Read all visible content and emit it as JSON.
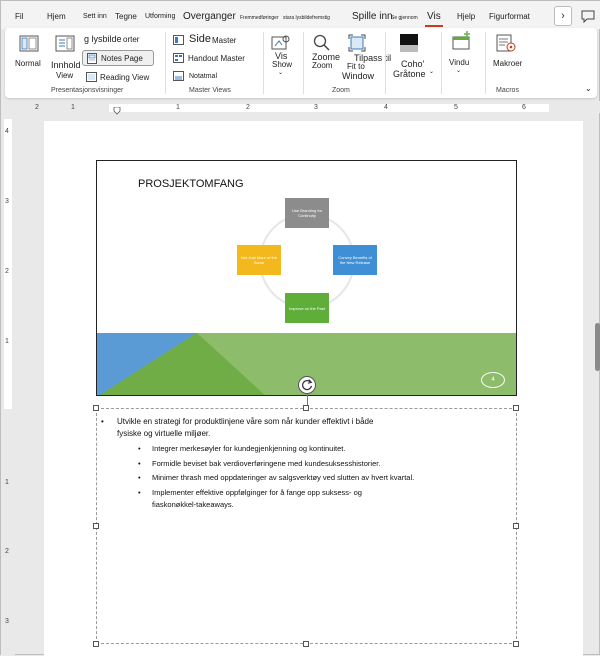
{
  "tabs": [
    {
      "label": "Fil",
      "active": false
    },
    {
      "label": "Hjem",
      "active": false
    },
    {
      "label": "Sett inn",
      "active": false
    },
    {
      "label": "Tegne",
      "active": false
    },
    {
      "label": "Utforming",
      "active": false
    },
    {
      "label": "Overganger",
      "active": false
    },
    {
      "label": "Fremmedføringer",
      "active": false
    },
    {
      "label": "stara lysbildefremstig",
      "active": false
    },
    {
      "label": "Spille inn",
      "active": false
    },
    {
      "label": "Se gjennom",
      "active": false
    },
    {
      "label": "Vis",
      "active": true
    },
    {
      "label": "Hjelp",
      "active": false
    },
    {
      "label": "Figurformat",
      "active": false
    }
  ],
  "more_tabs_icon": "chevron-right-icon",
  "comment_icon": "comment-icon",
  "ribbon": {
    "normal": "Normal",
    "innhold": "Innhold",
    "view": "View",
    "lysbilde": "g lysbilde",
    "sorter": "orter",
    "notes_page": "Notes Page",
    "reading_view": "Reading View",
    "group_presentasjon": "Presentasjonsvisninger",
    "side": "Side",
    "master": "Master",
    "handout_master": "Handout Master",
    "notatmal": "Notatmal",
    "group_master_views": "Master Views",
    "vis": "Vis",
    "show": "Show",
    "zoome": "Zoome",
    "zoom": "Zoom",
    "tilpass_til": "Tilpass til",
    "fit_to": "Fit to",
    "window": "Window",
    "group_zoom": "Zoom",
    "coho": "Coho'",
    "gratone": "Gråtone",
    "vindu": "Vindu",
    "makroer": "Makroer",
    "group_macros": "Macros",
    "collapse_icon": "chevron-down-icon"
  },
  "ruler_h": [
    "2",
    "1",
    "1",
    "2",
    "3",
    "4",
    "5",
    "6"
  ],
  "ruler_v": [
    "4",
    "3",
    "2",
    "1",
    "1",
    "2",
    "3"
  ],
  "slide": {
    "title": "PROSJEKTOMFANG",
    "boxes": {
      "top": "Use Branding for Continuity",
      "right": "Convey Benefits of the New Release",
      "bottom": "Improve on the Past",
      "left": "Not Just More of the Same"
    },
    "number": "4",
    "colors": {
      "top": "#8c8c8c",
      "right": "#3f8fd6",
      "bottom": "#5fae3a",
      "left": "#f2b81c",
      "blue": "#5b9bd5",
      "green_light": "#8dbd6a",
      "green_dark": "#70ad47"
    }
  },
  "notes": {
    "line1a": "Utvikle en strategi for produktlinjene våre som når kunder effektivt i både",
    "line1b": "fysiske og virtuelle miljøer.",
    "bullets": [
      "Integrer merkesøyler for kundegjenkjenning og kontinuitet.",
      "Formidle beviset bak verdioverføringene med kundesuksesshistorier.",
      "Minimer thrash med oppdateringer av salgsverktøy ved slutten av hvert kvartal.",
      "Implementer effektive oppfølginger for å fange opp suksess- og"
    ],
    "last_line": "fiaskonøkkel-takeaways."
  }
}
